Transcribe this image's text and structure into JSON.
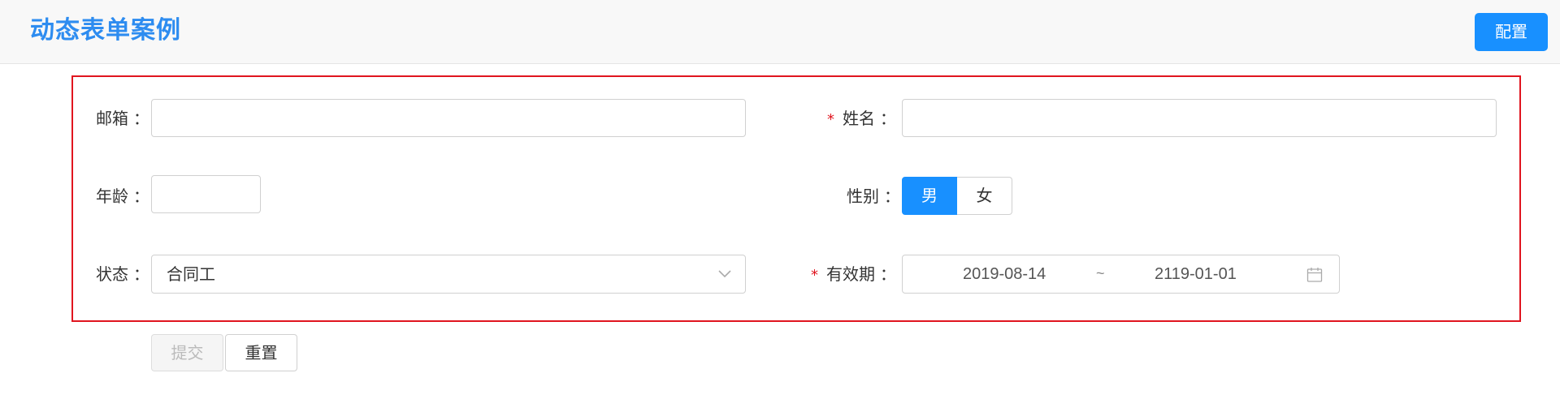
{
  "header": {
    "title": "动态表单案例",
    "config_label": "配置"
  },
  "form": {
    "email": {
      "label": "邮箱",
      "value": "",
      "placeholder": ""
    },
    "name": {
      "label": "姓名",
      "required_mark": "*",
      "value": "",
      "placeholder": ""
    },
    "age": {
      "label": "年龄",
      "value": "",
      "placeholder": ""
    },
    "gender": {
      "label": "性别",
      "options": [
        "男",
        "女"
      ],
      "selected": "男"
    },
    "status": {
      "label": "状态",
      "selected": "合同工",
      "icon": "chevron-down-icon"
    },
    "validity": {
      "label": "有效期",
      "required_mark": "*",
      "start": "2019-08-14",
      "separator": "~",
      "end": "2119-01-01",
      "icon": "calendar-icon"
    },
    "colon": "："
  },
  "actions": {
    "submit_label": "提交",
    "reset_label": "重置"
  },
  "colors": {
    "accent": "#1890ff",
    "title": "#2d8cf0",
    "highlight_border": "#e0151f"
  }
}
